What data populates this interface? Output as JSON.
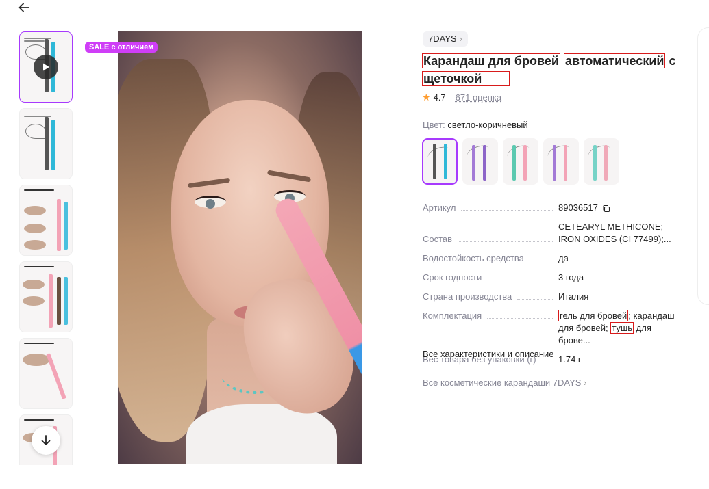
{
  "nav": {
    "back_icon": "arrow-left-icon"
  },
  "gallery": {
    "thumbnail_count": 6,
    "badge": "SALE с отличием"
  },
  "product": {
    "brand": "7DAYS",
    "title_parts": [
      "Карандаш для бровей",
      "автоматический",
      "с",
      "щеточкой"
    ],
    "rating": "4.7",
    "reviews": "671 оценка",
    "color_label": "Цвет:",
    "color_value": "светло-коричневый"
  },
  "specs": [
    {
      "name": "Артикул",
      "value": "89036517"
    },
    {
      "name": "Состав",
      "value": "CETEARYL METHICONE; IRON OXIDES (CI 77499);..."
    },
    {
      "name": "Водостойкость средства",
      "value": "да"
    },
    {
      "name": "Срок годности",
      "value": "3 года"
    },
    {
      "name": "Страна производства",
      "value": "Италия"
    },
    {
      "name": "Комплектация",
      "value_parts": [
        "гель для бровей",
        ";",
        " карандаш для бровей; ",
        "тушь",
        " для брове..."
      ]
    },
    {
      "name": "Вес товара без упаковки (г)",
      "value": "1.74 г"
    }
  ],
  "links": {
    "all_specs": "Все характеристики и описание",
    "all_category": "Все косметические карандаши 7DAYS"
  },
  "colors": {
    "accent": "#a73afd",
    "badge": "#cf3ef7",
    "highlight_box": "#d81b1b",
    "star": "#ff9d2f",
    "muted": "#868695"
  }
}
